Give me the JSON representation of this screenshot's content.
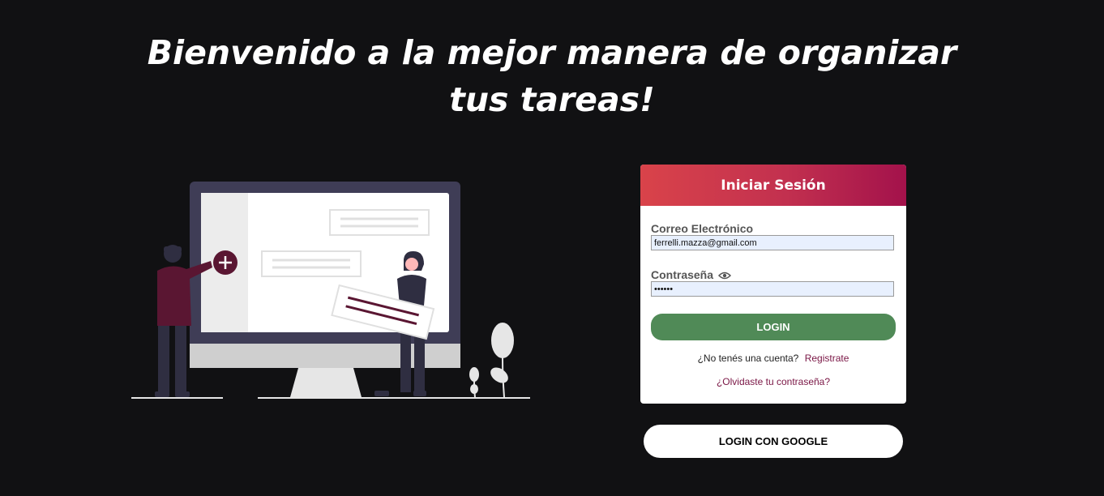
{
  "page": {
    "headline": "Bienvenido a la mejor manera de organizar tus tareas!"
  },
  "illustration": {
    "name": "people-with-monitor-illustration",
    "colors": {
      "monitor_frame": "#3f3d56",
      "screen": "#ffffff",
      "sidebar": "#ececec",
      "accent": "#5a1632",
      "ground": "#e6e6e6"
    }
  },
  "login_card": {
    "title": "Iniciar Sesión",
    "email_label": "Correo Electrónico",
    "email_value": "ferrelli.mazza@gmail.com",
    "password_label": "Contraseña",
    "password_icon": "eye-icon",
    "password_value": "••••••",
    "login_button": "LOGIN",
    "no_account_text": "¿No tenés una cuenta?",
    "register_link": "Registrate",
    "forgot_link": "¿Olvidaste tu contraseña?"
  },
  "google_button": "LOGIN CON GOOGLE",
  "colors": {
    "background": "#111113",
    "header_gradient_start": "#d9434a",
    "header_gradient_end": "#a3124b",
    "login_button": "#508a57",
    "link": "#7a1645",
    "input_bg": "#e8f0fe"
  }
}
